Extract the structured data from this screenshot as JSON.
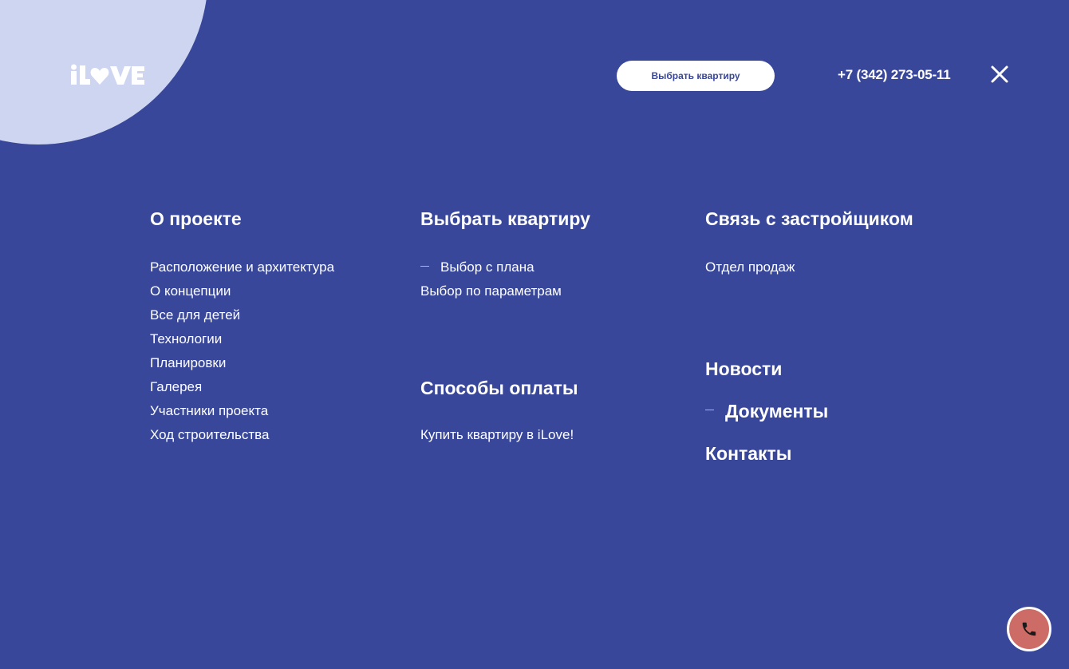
{
  "header": {
    "logo_text": "iLOVE",
    "cta_label": "Выбрать квартиру",
    "phone": "+7 (342) 273-05-11",
    "close_icon": "close-icon"
  },
  "menu": {
    "about": {
      "title": "О проекте",
      "items": [
        "Расположение и архитектура",
        "О концепции",
        "Все для детей",
        "Технологии",
        "Планировки",
        "Галерея",
        "Участники проекта",
        "Ход строительства"
      ]
    },
    "choose": {
      "title": "Выбрать квартиру",
      "items": [
        "Выбор с плана",
        "Выбор по параметрам"
      ],
      "active_index": 0
    },
    "payment": {
      "title": "Способы оплаты",
      "items": [
        "Купить квартиру в iLove!"
      ]
    },
    "developer": {
      "title": "Связь с застройщиком",
      "items": [
        "Отдел продаж"
      ]
    },
    "extra": {
      "news": "Новости",
      "documents": "Документы",
      "contacts": "Контакты",
      "active": "documents"
    }
  },
  "call_button": {
    "icon": "phone-icon"
  },
  "colors": {
    "background": "#38479a",
    "accent_circle": "#cdd5f0",
    "call_button": "#cd6b67",
    "text": "#ffffff"
  }
}
